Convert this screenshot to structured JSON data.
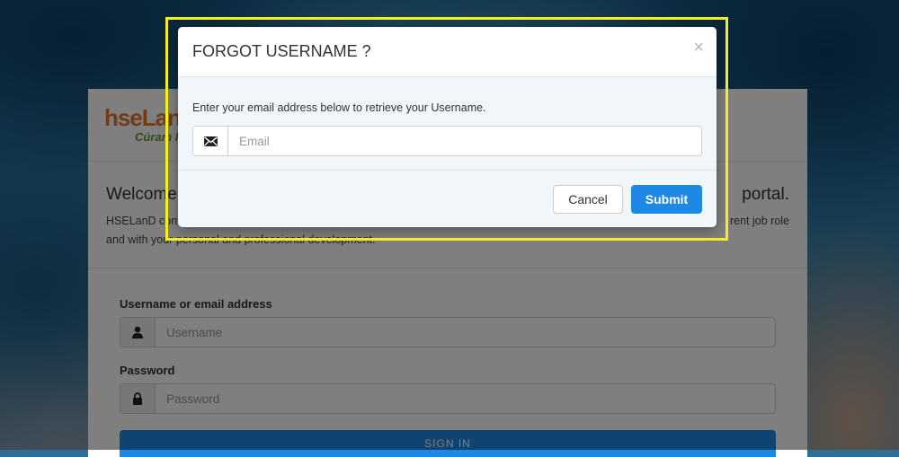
{
  "background_page": {
    "logo": {
      "main": "hseLanD",
      "sub": "Cúram Í"
    },
    "welcome_visible_left": "Welcome t",
    "welcome_visible_right": "portal.",
    "intro_line1_left": "HSELanD cont",
    "intro_line1_right": "rent job role",
    "intro_line2": "and with your personal and professional development.",
    "username_label": "Username or email address",
    "username_placeholder": "Username",
    "password_label": "Password",
    "password_placeholder": "Password",
    "signin_label": "SIGN IN"
  },
  "modal": {
    "title": "FORGOT USERNAME ?",
    "close_glyph": "×",
    "instructions": "Enter your email address below to retrieve your Username.",
    "email_placeholder": "Email",
    "email_icon": "envelope-icon",
    "cancel_label": "Cancel",
    "submit_label": "Submit"
  },
  "colors": {
    "primary": "#1e88e5",
    "highlight": "#f5ee1e",
    "logo_orange": "#e8742b",
    "logo_green": "#5d9a34"
  }
}
